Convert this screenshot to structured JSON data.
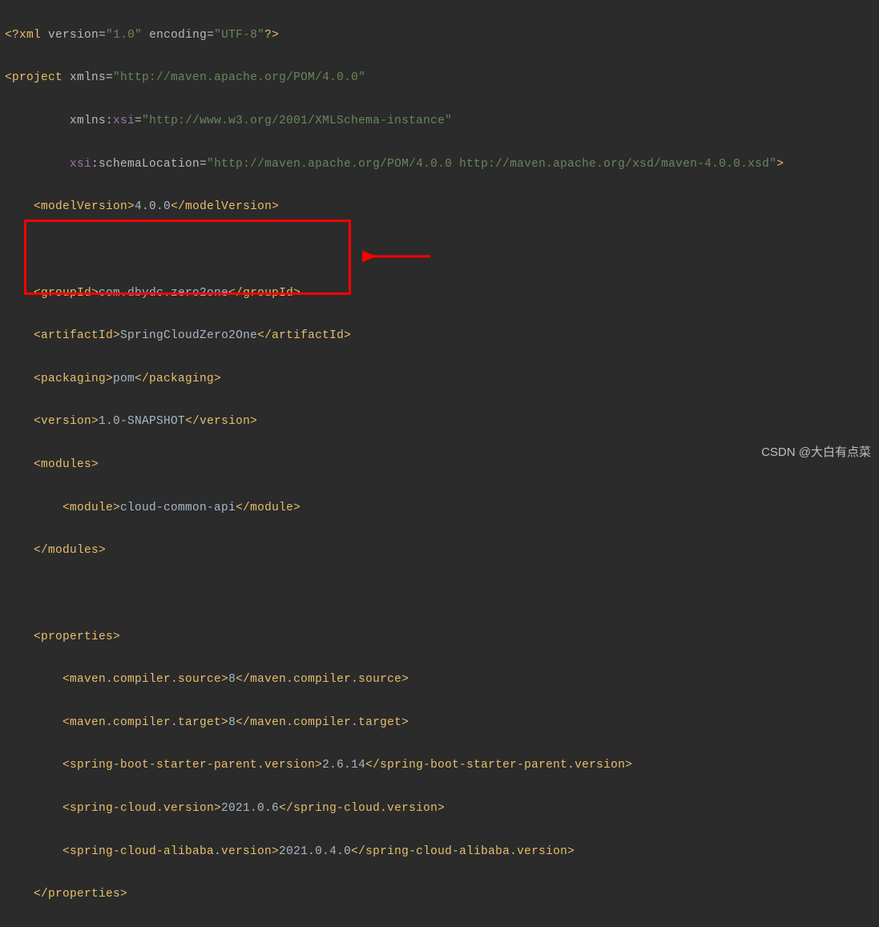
{
  "xml": {
    "xml_decl_open": "<?",
    "xml_decl_name": "xml ",
    "version_attr": "version",
    "version_val": "\"1.0\"",
    "encoding_attr": " encoding",
    "encoding_val": "\"UTF-8\"",
    "xml_decl_close": "?>",
    "project_open": "<project ",
    "xmlns_attr": "xmlns",
    "xmlns_val": "\"http://maven.apache.org/POM/4.0.0\"",
    "xmlns_xsi_prefix": "xmlns:",
    "xmlns_xsi_name": "xsi",
    "xmlns_xsi_val": "\"http://www.w3.org/2001/XMLSchema-instance\"",
    "xsi_prefix": "xsi",
    "schema_loc_name": ":schemaLocation",
    "schema_loc_val": "\"http://maven.apache.org/POM/4.0.0 http://maven.apache.org/xsd/maven-4.0.0.xsd\"",
    "tag_close": ">",
    "modelVersion_open": "<modelVersion>",
    "modelVersion_val": "4.0.0",
    "modelVersion_close": "</modelVersion>",
    "groupId_open": "<groupId>",
    "groupId_val": "com.dbydc.zero2one",
    "groupId_close": "</groupId>",
    "artifactId_open": "<artifactId>",
    "artifactId_val": "SpringCloudZero2One",
    "artifactId_close": "</artifactId>",
    "packaging_open": "<packaging>",
    "packaging_val": "pom",
    "packaging_close": "</packaging>",
    "version_open": "<version>",
    "version_val_txt": "1.0-SNAPSHOT",
    "version_close": "</version>",
    "modules_open": "<modules>",
    "module_open": "<module>",
    "module_val": "cloud-common-api",
    "module_close": "</module>",
    "modules_close": "</modules>",
    "properties_open": "<properties>",
    "mcs_open": "<maven.compiler.source>",
    "mcs_val": "8",
    "mcs_close": "</maven.compiler.source>",
    "mct_open": "<maven.compiler.target>",
    "mct_val": "8",
    "mct_close": "</maven.compiler.target>",
    "sbsp_open": "<spring-boot-starter-parent.version>",
    "sbsp_val": "2.6.14",
    "sbsp_close": "</spring-boot-starter-parent.version>",
    "scv_open": "<spring-cloud.version>",
    "scv_val": "2021.0.6",
    "scv_close": "</spring-cloud.version>",
    "scav_open": "<spring-cloud-alibaba.version>",
    "scav_val": "2021.0.4.0",
    "scav_close": "</spring-cloud-alibaba.version>",
    "properties_close": "</properties>"
  },
  "watermark": "CSDN @大白有点菜"
}
